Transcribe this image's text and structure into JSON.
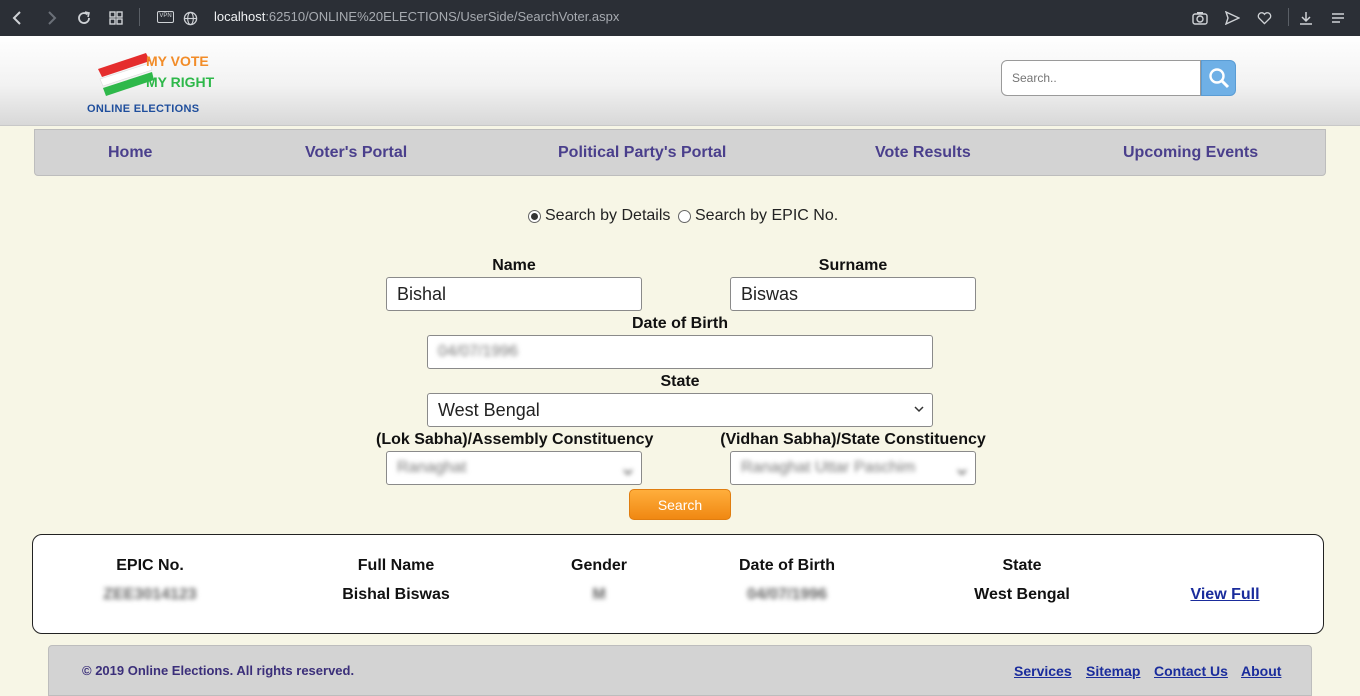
{
  "browser": {
    "url_host": "localhost",
    "url_rest": ":62510/ONLINE%20ELECTIONS/UserSide/SearchVoter.aspx",
    "vpn_label": "VPN"
  },
  "logo": {
    "line1": "MY VOTE",
    "line2": "MY RIGHT",
    "line3": "ONLINE ELECTIONS"
  },
  "header_search": {
    "placeholder": "Search.."
  },
  "nav": {
    "items": [
      {
        "label": "Home"
      },
      {
        "label": "Voter's Portal"
      },
      {
        "label": "Political Party's Portal"
      },
      {
        "label": "Vote Results"
      },
      {
        "label": "Upcoming Events"
      }
    ]
  },
  "form": {
    "radio_details": "Search by Details",
    "radio_epic": "Search by EPIC No.",
    "selected_mode": "details",
    "name_label": "Name",
    "name_value": "Bishal",
    "surname_label": "Surname",
    "surname_value": "Biswas",
    "dob_label": "Date of Birth",
    "dob_value": "04/07/1996",
    "state_label": "State",
    "state_value": "West Bengal",
    "lok_label": "(Lok Sabha)/Assembly Constituency",
    "lok_value": "Ranaghat",
    "vidhan_label": "(Vidhan Sabha)/State Constituency",
    "vidhan_value": "Ranaghat Uttar Paschim",
    "search_button": "Search"
  },
  "result": {
    "headers": [
      "EPIC No.",
      "Full Name",
      "Gender",
      "Date of Birth",
      "State"
    ],
    "row": {
      "epic": "ZEE3014123",
      "full_name": "Bishal Biswas",
      "gender": "M",
      "dob": "04/07/1996",
      "state": "West Bengal",
      "view_link": "View Full"
    }
  },
  "footer": {
    "copyright": "© 2019 Online Elections. All rights reserved.",
    "links": [
      "Services",
      "Sitemap",
      "Contact Us",
      "About"
    ]
  },
  "colors": {
    "nav_text": "#4a3f8c",
    "link": "#1a2c9c",
    "search_button": "#f08812",
    "page_background": "#f7f6e6"
  }
}
